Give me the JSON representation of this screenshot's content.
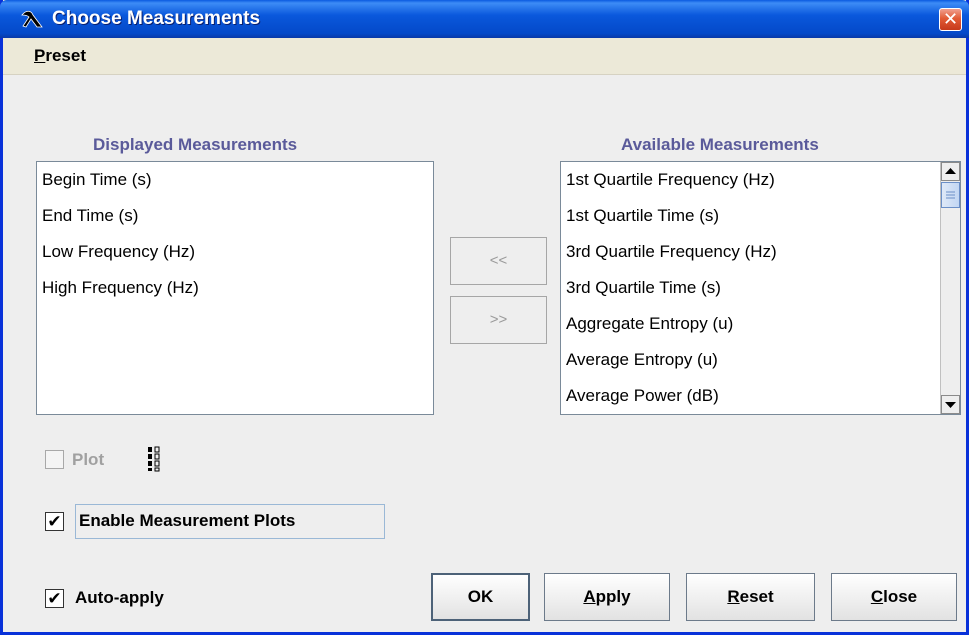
{
  "window": {
    "title": "Choose Measurements",
    "close_glyph": "✕",
    "title_icon": "raven-logo-icon"
  },
  "menubar": {
    "items": [
      {
        "label": "Preset",
        "mnemonic": "P",
        "rest": "reset"
      }
    ]
  },
  "displayed": {
    "title": "Displayed Measurements",
    "items": [
      "Begin Time (s)",
      "End Time (s)",
      "Low Frequency (Hz)",
      "High Frequency (Hz)"
    ]
  },
  "available": {
    "title": "Available Measurements",
    "items": [
      "1st Quartile Frequency (Hz)",
      "1st Quartile Time (s)",
      "3rd Quartile Frequency (Hz)",
      "3rd Quartile Time (s)",
      "Aggregate Entropy (u)",
      "Average Entropy (u)",
      "Average Power (dB)"
    ]
  },
  "move": {
    "add_label": "<<",
    "remove_label": ">>"
  },
  "plot": {
    "label": "Plot",
    "checked": false,
    "enabled": false,
    "icon": "plot-layout-icon"
  },
  "enable_plots": {
    "label": "Enable Measurement Plots",
    "checked": true,
    "check_glyph": "✔"
  },
  "auto_apply": {
    "label": "Auto-apply",
    "checked": true,
    "check_glyph": "✔"
  },
  "buttons": {
    "ok": {
      "label": "OK"
    },
    "apply": {
      "mnemonic": "A",
      "rest": "pply"
    },
    "reset": {
      "mnemonic": "R",
      "rest": "eset"
    },
    "close": {
      "mnemonic": "C",
      "rest": "lose"
    }
  },
  "colors": {
    "title_blue": "#0a58dc",
    "list_heading": "#5a5a9a",
    "close_red": "#e25b35"
  }
}
